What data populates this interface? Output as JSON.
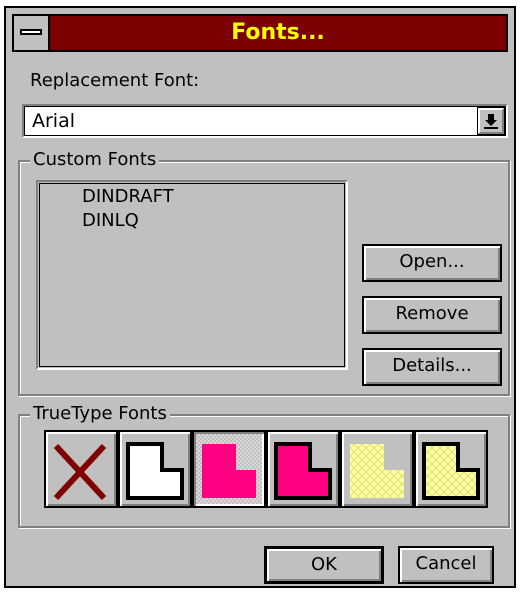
{
  "window": {
    "title": "Fonts..."
  },
  "replacement": {
    "label": "Replacement Font:",
    "value": "Arial"
  },
  "custom_fonts": {
    "group_label": "Custom Fonts",
    "items": [
      "DINDRAFT",
      "DINLQ"
    ],
    "buttons": {
      "open": "Open...",
      "remove": "Remove",
      "details": "Details..."
    }
  },
  "truetype": {
    "group_label": "TrueType Fonts",
    "options": [
      {
        "icon": "x-icon"
      },
      {
        "icon": "outline-corner-icon"
      },
      {
        "icon": "pink-corner-icon",
        "selected": true
      },
      {
        "icon": "pink-corner-outlined-icon"
      },
      {
        "icon": "yellow-hatched-corner-icon"
      },
      {
        "icon": "yellow-hatched-corner-outlined-icon"
      }
    ]
  },
  "footer": {
    "ok": "OK",
    "cancel": "Cancel"
  },
  "colors": {
    "title_bg": "#7b0000",
    "title_text": "#ffff00",
    "pink": "#ff0080",
    "yellow": "#ffffa8",
    "face": "#c0c0c0"
  }
}
